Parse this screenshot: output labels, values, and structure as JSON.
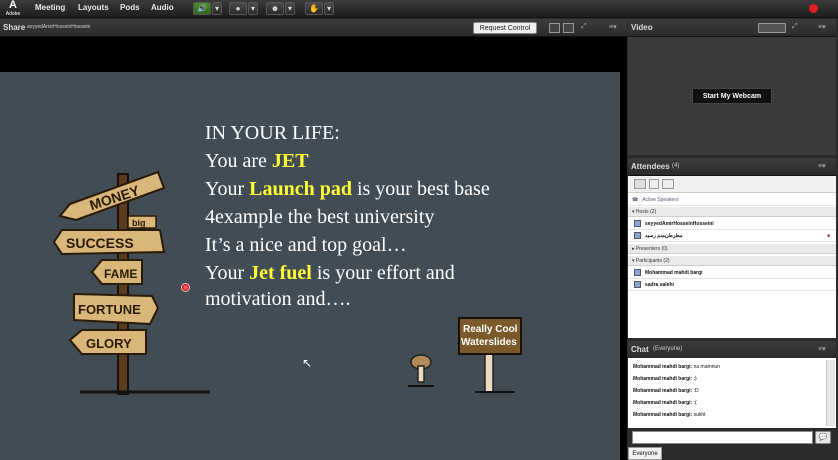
{
  "toolbar": {
    "logo_letter": "A",
    "logo_text": "Adobe",
    "menus": [
      "Meeting",
      "Layouts",
      "Pods",
      "Audio"
    ]
  },
  "share_pod": {
    "title": "Share",
    "presenter": "- seyyedAmirHosseinHosseini",
    "request_control": "Request Control"
  },
  "slide": {
    "heading": "IN YOUR LIFE:",
    "line1_pre": "You are ",
    "line1_hl": "JET",
    "line2_pre": "Your ",
    "line2_hl": "Launch pad",
    "line2_post": " is your best base",
    "line3": "4example the best university",
    "line4": "It’s a nice and top goal…",
    "line5_pre": "Your ",
    "line5_hl": "Jet fuel",
    "line5_post": "  is your effort and",
    "line6": "motivation and….",
    "signs": [
      "MONEY",
      "big",
      "SUCCESS",
      "FAME",
      "FORTUNE",
      "GLORY"
    ],
    "waterslide_line1": "Really Cool",
    "waterslide_line2": "Waterslides"
  },
  "video_pod": {
    "title": "Video",
    "start_webcam": "Start My Webcam"
  },
  "attendees_pod": {
    "title": "Attendees",
    "count": "(4)",
    "active_speakers": "Active Speakers",
    "hosts_label": "Hosts (2)",
    "hosts": [
      "seyyedAmirHosseinHosseini",
      "مطرطريمنم رسيد"
    ],
    "presenters_label": "Presenters (0)",
    "participants_label": "Participants (2)",
    "participants": [
      "Mohammad mahdi bargi",
      "sadra salehi"
    ]
  },
  "chat_pod": {
    "title": "Chat",
    "scope": "(Everyone)",
    "messages": [
      {
        "sender": "Mohammad mahdi bargi:",
        "text": "na mamnun"
      },
      {
        "sender": "Mohammad mahdi bargi:",
        "text": ":)"
      },
      {
        "sender": "Mohammad mahdi bargi:",
        "text": ":D"
      },
      {
        "sender": "Mohammad mahdi bargi:",
        "text": ":("
      },
      {
        "sender": "Mohammad mahdi bargi:",
        "text": "sukht"
      }
    ],
    "recipient": "Everyone"
  },
  "colors": {
    "slide_bg": "#424c55",
    "highlight": "#ffff33",
    "mic_green": "#3a7a22",
    "status_red": "#e02020"
  }
}
